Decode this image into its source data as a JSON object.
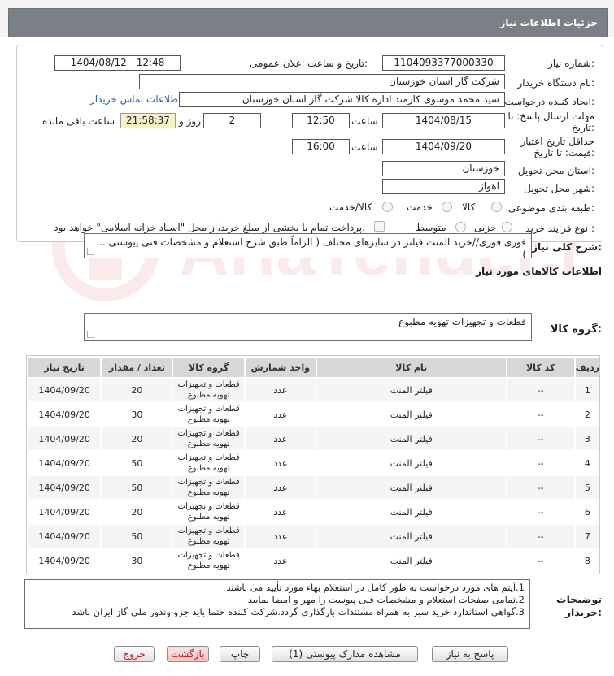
{
  "header": {
    "title": "جزئیات اطلاعات نیاز"
  },
  "fields": {
    "need_number_label": "شماره نیاز:",
    "need_number": "1104093377000330",
    "announce_label": "تاریخ و ساعت اعلان عمومی:",
    "announce_value": "1404/08/12 - 12:48",
    "buyer_org_label": "نام دستگاه خریدار:",
    "buyer_org": "شرکت گاز استان خوزستان",
    "creator_label": "ایجاد کننده درخواست:",
    "creator": "سید محمد موسوی کارمند اداره کالا شرکت گاز استان خوزستان",
    "contact_link": "اطلاعات تماس خریدار",
    "deadline_label": "مهلت ارسال پاسخ: تا تاریخ:",
    "deadline_date": "1404/08/15",
    "time_label": "ساعت",
    "deadline_time": "12:50",
    "days": "2",
    "day_word": "روز و",
    "remaining": "21:58:37",
    "remaining_label": "ساعت باقی مانده",
    "validity_label": "حداقل تاریخ اعتبار قیمت: تا تاریخ:",
    "validity_date": "1404/09/20",
    "validity_time": "16:00",
    "province_label": "استان محل تحویل:",
    "province": "خوزستان",
    "city_label": "شهر محل تحویل:",
    "city": "اهواز",
    "category_label": "طبقه بندی موضوعی:",
    "category_options": [
      "کالا",
      "خدمت",
      "کالا/خدمت"
    ],
    "process_label": "نوع فرآیند خرید :",
    "process_options": [
      "جزیی",
      "متوسط"
    ],
    "payment_note": "پرداخت تمام یا بخشی از مبلغ خرید،از محل \"اسناد خزانه اسلامی\" خواهد بود."
  },
  "description": {
    "label": "شرح کلی نیاز:",
    "text": "فوری فوری//خرید المنت فیلتر در سایزهای مختلف ( الزاماً طبق شرح استعلام و مشخصات فنی پیوستی.... )"
  },
  "goods_info": {
    "title": "اطلاعات کالاهای مورد نیاز",
    "group_label": "گروه کالا:",
    "group_value": "قطعات و تجهیزات تهویه مطبوع"
  },
  "table": {
    "headers": [
      "ردیف",
      "کد کالا",
      "نام کالا",
      "واحد شمارش",
      "گروه کالا",
      "تعداد / مقدار",
      "تاریخ نیاز"
    ],
    "rows": [
      [
        "1",
        "--",
        "فیلتر المنت",
        "عدد",
        "قطعات و تجهیزات تهویه مطبوع",
        "20",
        "1404/09/20"
      ],
      [
        "2",
        "--",
        "فیلتر المنت",
        "عدد",
        "قطعات و تجهیزات تهویه مطبوع",
        "30",
        "1404/09/20"
      ],
      [
        "3",
        "--",
        "فیلتر المنت",
        "عدد",
        "قطعات و تجهیزات تهویه مطبوع",
        "20",
        "1404/09/20"
      ],
      [
        "4",
        "--",
        "فیلتر المنت",
        "عدد",
        "قطعات و تجهیزات تهویه مطبوع",
        "50",
        "1404/09/20"
      ],
      [
        "5",
        "--",
        "فیلتر المنت",
        "عدد",
        "قطعات و تجهیزات تهویه مطبوع",
        "50",
        "1404/09/20"
      ],
      [
        "6",
        "--",
        "فیلتر المنت",
        "عدد",
        "قطعات و تجهیزات تهویه مطبوع",
        "20",
        "1404/09/20"
      ],
      [
        "7",
        "--",
        "فیلتر المنت",
        "عدد",
        "قطعات و تجهیزات تهویه مطبوع",
        "50",
        "1404/09/20"
      ],
      [
        "8",
        "--",
        "فیلتر المنت",
        "عدد",
        "قطعات و تجهیزات تهویه مطبوع",
        "30",
        "1404/09/20"
      ]
    ]
  },
  "buyer_notes": {
    "label": "توضیحات خریدار:",
    "lines": [
      "1.آیتم های مورد درخواست به طور کامل در استعلام بهاء مورد تأیید می باشند",
      "2.تمامی صفحات استعلام و مشخصات فنی پیوست را مهر و امضا نمایید",
      "3.گواهی استاندارد خرید سبز به همراه مستندات بارگذاری گردد.شرکت کننده حتما باید جزو وندور ملی گاز ایران باشد"
    ]
  },
  "buttons": {
    "reply": "پاسخ به نیاز",
    "attachments": "مشاهده مدارک پیوستی (1)",
    "print": "چاپ",
    "back": "بازگشت",
    "exit": "خروج"
  },
  "watermark": "AriaTender.net",
  "colors": {
    "header_bg": "#7b8086",
    "link": "#1a5cb8",
    "remaining_bg": "#f5f2c8",
    "exit_text": "#c01818"
  }
}
